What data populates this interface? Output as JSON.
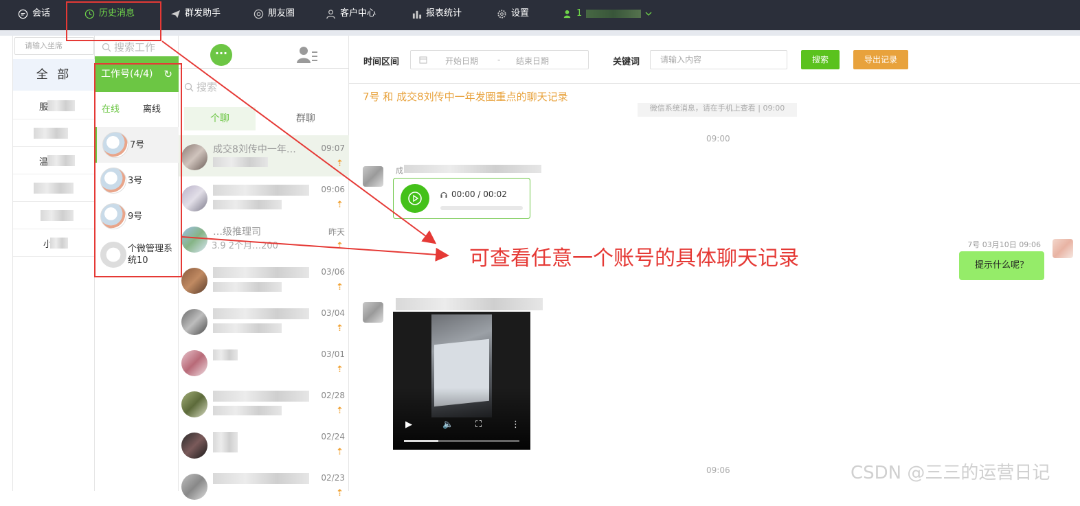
{
  "nav": {
    "items": [
      {
        "label": "会话",
        "icon": "chat-bubble-icon"
      },
      {
        "label": "历史消息",
        "icon": "clock-icon"
      },
      {
        "label": "群发助手",
        "icon": "send-icon"
      },
      {
        "label": "朋友圈",
        "icon": "aperture-icon"
      },
      {
        "label": "客户中心",
        "icon": "person-icon"
      },
      {
        "label": "报表统计",
        "icon": "bar-chart-icon"
      },
      {
        "label": "设置",
        "icon": "gear-icon"
      }
    ],
    "user_prefix": "1"
  },
  "seats": {
    "search_placeholder": "请输入坐席",
    "all_label": "全 部",
    "row_prefixes": [
      "服",
      "",
      "温",
      "",
      "",
      "小"
    ]
  },
  "workers": {
    "search_placeholder": "搜索工作",
    "header": "工作号(4/4)",
    "tab_online": "在线",
    "tab_offline": "离线",
    "accounts": [
      "7号",
      "3号",
      "9号",
      "个微管理系统10"
    ]
  },
  "chats": {
    "search_placeholder": "搜索",
    "tab_single": "个聊",
    "tab_group": "群聊",
    "items": [
      {
        "time": "09:07",
        "text": "成交8刘传中一年…",
        "sub": ""
      },
      {
        "time": "09:06",
        "text": "",
        "sub": ""
      },
      {
        "time": "昨天",
        "text": "…级推理司",
        "sub": "3.9 2个月…200"
      },
      {
        "time": "03/06",
        "text": "",
        "sub": ""
      },
      {
        "time": "03/04",
        "text": "",
        "sub": ""
      },
      {
        "time": "03/01",
        "text": "",
        "sub": ""
      },
      {
        "time": "02/28",
        "text": "",
        "sub": ""
      },
      {
        "time": "02/24",
        "text": "",
        "sub": ""
      },
      {
        "time": "02/23",
        "text": "",
        "sub": ""
      }
    ],
    "arrow_glyph": "⇡"
  },
  "history": {
    "time_range_label": "时间区间",
    "start_placeholder": "开始日期",
    "range_sep": "-",
    "end_placeholder": "结束日期",
    "keyword_label": "关键词",
    "keyword_placeholder": "请输入内容",
    "search_button": "搜索",
    "export_button": "导出记录",
    "chat_title": "7号 和 成交8刘传中一年发圈重点的聊天记录",
    "system_note": "微信系统消息，请在手机上查看 | 09:00",
    "time_1": "09:00",
    "sender_prefix": "成",
    "voice_time": "00:00 / 00:02",
    "right_meta": "7号 03月10日 09:06",
    "right_bubble": "提示什么呢？",
    "time_2": "09:06",
    "video_progress": 0.3
  },
  "annotation": "可查看任意一个账号的具体聊天记录",
  "watermark": "CSDN @三三的运营日记",
  "colors": {
    "accent": "#6cc644",
    "annot": "#e53935",
    "export": "#e8a23c",
    "topbar": "#2b2f3a"
  }
}
